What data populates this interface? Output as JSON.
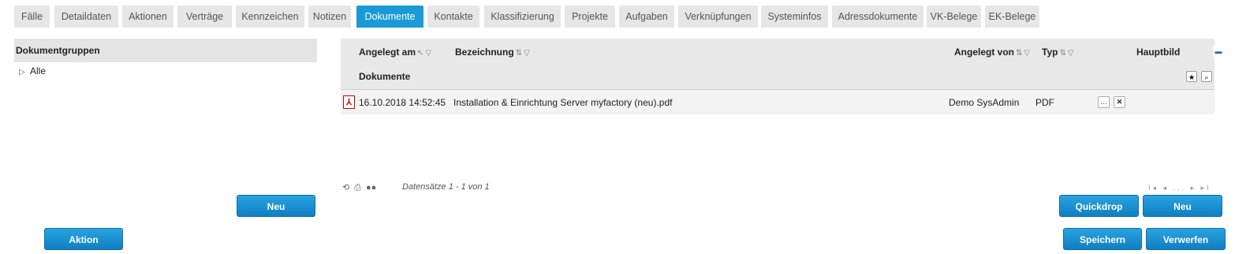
{
  "tabs": [
    "Fälle",
    "Detaildaten",
    "Aktionen",
    "Verträge",
    "Kennzeichen",
    "Notizen",
    "Dokumente",
    "Kontakte",
    "Klassifizierung",
    "Projekte",
    "Aufgaben",
    "Verknüpfungen",
    "Systeminfos",
    "Adressdokumente",
    "VK-Belege",
    "EK-Belege"
  ],
  "active_tab": "Dokumente",
  "left_panel": {
    "header": "Dokumentgruppen",
    "tree": [
      {
        "label": "Alle"
      }
    ],
    "new_button": "Neu",
    "action_button": "Aktion"
  },
  "grid": {
    "columns": {
      "created_at": "Angelegt am",
      "name": "Bezeichnung",
      "created_by": "Angelegt von",
      "type": "Typ",
      "main_image": "Hauptbild"
    },
    "group_label": "Dokumente",
    "rows": [
      {
        "created_at": "16.10.2018 14:52:45",
        "name": "Installation & Einrichtung Server myfactory (neu).pdf",
        "created_by": "Demo SysAdmin",
        "type": "PDF"
      }
    ],
    "records_text": "Datensätze 1 - 1 von 1",
    "pager_text": "I◂ ◂ ... ▸ ▸I"
  },
  "buttons": {
    "quickdrop": "Quickdrop",
    "new": "Neu",
    "save": "Speichern",
    "discard": "Verwerfen"
  },
  "colors": {
    "accent": "#1a9ad6",
    "button": "#1580c8"
  }
}
